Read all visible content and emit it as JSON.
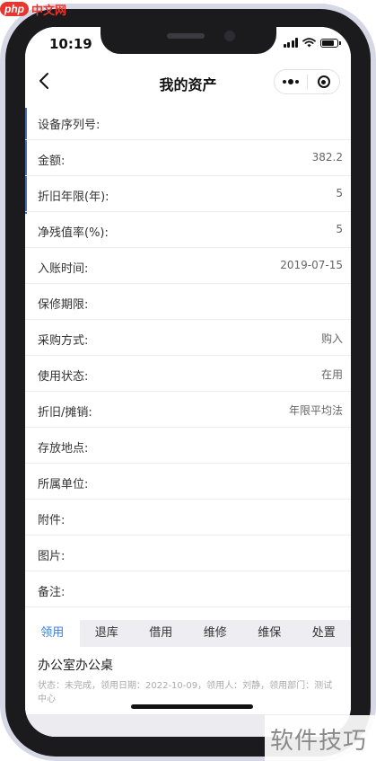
{
  "watermark_top": {
    "logo": "php",
    "text": "中文网"
  },
  "watermark_bottom": {
    "text": "软件技巧"
  },
  "status_bar": {
    "time": "10:19"
  },
  "nav": {
    "title": "我的资产",
    "back_icon": "chevron-left-icon",
    "more_icon": "ellipsis-icon",
    "close_icon": "target-icon"
  },
  "colors": {
    "accent": "#4a6fb3",
    "active_tab": "#3d7bd9",
    "frame": "#1b1b1d"
  },
  "fields": [
    {
      "label": "设备序列号:",
      "value": ""
    },
    {
      "label": "金额:",
      "value": "382.2"
    },
    {
      "label": "折旧年限(年):",
      "value": "5"
    },
    {
      "label": "净残值率(%):",
      "value": "5"
    },
    {
      "label": "入账时间:",
      "value": "2019-07-15"
    },
    {
      "label": "保修期限:",
      "value": ""
    },
    {
      "label": "采购方式:",
      "value": "购入"
    },
    {
      "label": "使用状态:",
      "value": "在用"
    },
    {
      "label": "折旧/摊销:",
      "value": "年限平均法"
    },
    {
      "label": "存放地点:",
      "value": ""
    },
    {
      "label": "所属单位:",
      "value": ""
    },
    {
      "label": "附件:",
      "value": ""
    },
    {
      "label": "图片:",
      "value": ""
    },
    {
      "label": "备注:",
      "value": ""
    }
  ],
  "tabs": [
    "领用",
    "退库",
    "借用",
    "维修",
    "维保",
    "处置"
  ],
  "active_tab": "领用",
  "record": {
    "title": "办公室办公桌",
    "detail": "状态：未完成，领用日期：2022-10-09，领用人：刘静，领用部门：测试中心"
  }
}
